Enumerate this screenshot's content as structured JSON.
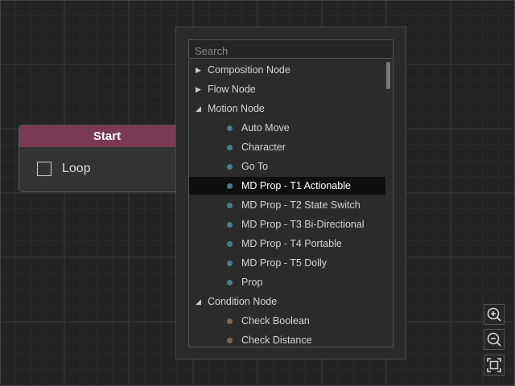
{
  "node": {
    "title": "Start",
    "checkbox_label": "Loop"
  },
  "search": {
    "placeholder": "Search"
  },
  "tree": [
    {
      "type": "category",
      "label": "Composition Node",
      "expanded": false
    },
    {
      "type": "category",
      "label": "Flow Node",
      "expanded": false
    },
    {
      "type": "category",
      "label": "Motion Node",
      "expanded": true
    },
    {
      "type": "item",
      "label": "Auto Move",
      "color": "#4d7b8c"
    },
    {
      "type": "item",
      "label": "Character",
      "color": "#4d7b8c"
    },
    {
      "type": "item",
      "label": "Go To",
      "color": "#4d7b8c"
    },
    {
      "type": "item",
      "label": "MD Prop - T1 Actionable",
      "color": "#4d7b8c",
      "selected": true
    },
    {
      "type": "item",
      "label": "MD Prop - T2 State Switch",
      "color": "#4d7b8c"
    },
    {
      "type": "item",
      "label": "MD Prop - T3 Bi-Directional",
      "color": "#4d7b8c"
    },
    {
      "type": "item",
      "label": "MD Prop - T4 Portable",
      "color": "#4d7b8c"
    },
    {
      "type": "item",
      "label": "MD Prop - T5 Dolly",
      "color": "#4d7b8c"
    },
    {
      "type": "item",
      "label": "Prop",
      "color": "#4d7b8c"
    },
    {
      "type": "category",
      "label": "Condition Node",
      "expanded": true
    },
    {
      "type": "item",
      "label": "Check Boolean",
      "color": "#7d6a55"
    },
    {
      "type": "item",
      "label": "Check Distance",
      "color": "#7d6a55"
    }
  ],
  "icons": {
    "zoom_in": "zoom-in-icon",
    "zoom_out": "zoom-out-icon",
    "fit": "fit-view-icon"
  },
  "colors": {
    "node_header": "#7a3a55",
    "selected_row": "#0f0f0f"
  }
}
